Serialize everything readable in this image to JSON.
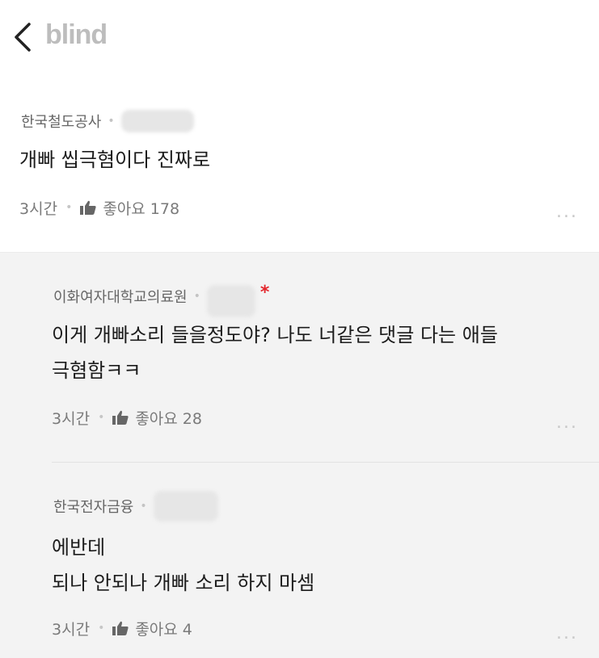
{
  "header": {
    "back_icon": "chevron-left-icon",
    "logo_text": "blind"
  },
  "post": {
    "company": "한국철도공사",
    "content": "개빠 씹극혐이다 진짜로",
    "time": "3시간",
    "like_label": "좋아요 178",
    "more": "..."
  },
  "comments": [
    {
      "company": "이화여자대학교의료원",
      "verified_mark": "*",
      "content_line1": "이게 개빠소리 들을정도야? 나도 너같은 댓글 다는 애들",
      "content_line2": "극혐함ㅋㅋ",
      "time": "3시간",
      "like_label": "좋아요 28",
      "more": "..."
    },
    {
      "company": "한국전자금융",
      "content_line1": "에반데",
      "content_line2": "되나 안되나 개빠 소리 하지 마셈",
      "time": "3시간",
      "like_label": "좋아요 4",
      "more": "..."
    }
  ],
  "colors": {
    "logo": "#bdbdbd",
    "verified_mark": "#e3262c",
    "comment_bg": "#f3f3f3"
  }
}
